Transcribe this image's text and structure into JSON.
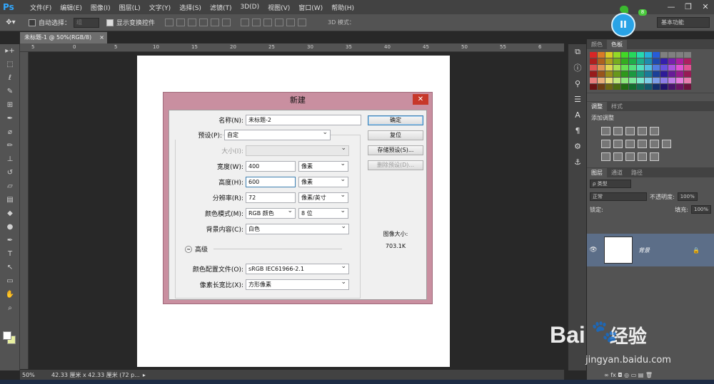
{
  "app": {
    "logo": "Ps"
  },
  "menu": [
    "文件(F)",
    "编辑(E)",
    "图像(I)",
    "图层(L)",
    "文字(Y)",
    "选择(S)",
    "滤镜(T)",
    "3D(D)",
    "视图(V)",
    "窗口(W)",
    "帮助(H)"
  ],
  "window_controls": {
    "minimize": "—",
    "restore": "❐",
    "close": "✕"
  },
  "options": {
    "tool_icon": "move-tool-icon",
    "auto_select_label": "自动选择：",
    "auto_select_value": "组",
    "show_transform_label": "显示变换控件",
    "mode3d_label": "3D 模式：",
    "workspace": "基本功能"
  },
  "document": {
    "tab_title": "未标题-1 @ 50%(RGB/8)",
    "tab_close": "×",
    "zoom": "50%",
    "status_info": "42.33 厘米 x 42.33 厘米 (72 p..."
  },
  "ruler": {
    "h_labels": [
      "5",
      "0",
      "5",
      "10",
      "15",
      "20",
      "25",
      "30",
      "35",
      "40",
      "45",
      "50",
      "55",
      "6"
    ]
  },
  "panels": {
    "color_tab": "颜色",
    "swatches_tab": "色板",
    "adjust_tab": "调整",
    "styles_tab": "样式",
    "adjust_title": "添加调整",
    "layers_tab": "图层",
    "channels_tab": "通道",
    "paths_tab": "路径",
    "filter_kind": "ρ 类型",
    "blend_mode": "正常",
    "opacity_label": "不透明度:",
    "opacity_value": "100%",
    "lock_label": "锁定:",
    "fill_label": "填充:",
    "fill_value": "100%",
    "layer_name": "背景",
    "layer_eye": "👁",
    "layer_lock": "🔒",
    "footer_icons": "∞  fx  ◘  ◎  ▭  ▤  🗑"
  },
  "dialog": {
    "title": "新建",
    "close": "✕",
    "name_label": "名称(N):",
    "name_value": "未标题-2",
    "preset_label": "预设(P):",
    "preset_value": "自定",
    "size_label": "大小(I):",
    "width_label": "宽度(W):",
    "width_value": "400",
    "width_unit": "像素",
    "height_label": "高度(H):",
    "height_value": "600",
    "height_unit": "像素",
    "resolution_label": "分辨率(R):",
    "resolution_value": "72",
    "resolution_unit": "像素/英寸",
    "color_mode_label": "颜色模式(M):",
    "color_mode_value": "RGB 颜色",
    "bit_depth": "8 位",
    "background_label": "背景内容(C):",
    "background_value": "白色",
    "advanced_toggle": "≈",
    "advanced_label": "高级",
    "profile_label": "颜色配置文件(O):",
    "profile_value": "sRGB IEC61966-2.1",
    "pixel_aspect_label": "像素长宽比(X):",
    "pixel_aspect_value": "方形像素",
    "ok": "确定",
    "reset": "复位",
    "save_preset": "存储预设(S)...",
    "delete_preset": "删除预设(D)...",
    "image_size_label": "图像大小:",
    "image_size_value": "703.1K"
  },
  "widget": {
    "pause": "II",
    "badge": "8"
  },
  "watermark": {
    "brand": "Bai",
    "brand2": "经验",
    "url": "jingyan.baidu.com"
  },
  "colors": {
    "accent": "#31a8ff",
    "dialog_frame": "#c98fa0",
    "close_red": "#c7372a",
    "layer_selected": "#5c6e88"
  }
}
